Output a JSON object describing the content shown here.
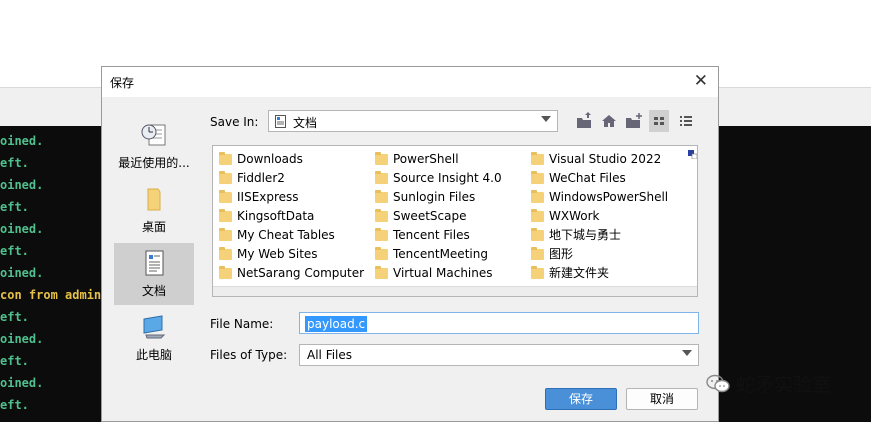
{
  "terminal": {
    "lines": [
      {
        "text": "oined.",
        "color": "green"
      },
      {
        "text": "eft.",
        "color": "green"
      },
      {
        "text": "oined.",
        "color": "green"
      },
      {
        "text": "eft.",
        "color": "green"
      },
      {
        "text": "oined.",
        "color": "green"
      },
      {
        "text": "eft.",
        "color": "green"
      },
      {
        "text": "oined.",
        "color": "green"
      },
      {
        "text": "con from admin@",
        "color": "yellow"
      },
      {
        "text": "eft.",
        "color": "green"
      },
      {
        "text": "oined.",
        "color": "green"
      },
      {
        "text": "eft.",
        "color": "green"
      },
      {
        "text": "oined.",
        "color": "green"
      },
      {
        "text": "eft.",
        "color": "green"
      }
    ]
  },
  "dialog": {
    "title": "保存",
    "close": "✕",
    "save_in": {
      "label": "Save In:",
      "value": "文档"
    },
    "places": [
      {
        "name": "recent",
        "label": "最近使用的...",
        "icon": "recent-items-icon",
        "selected": false
      },
      {
        "name": "desktop",
        "label": "桌面",
        "icon": "desktop-folder-icon",
        "selected": false
      },
      {
        "name": "documents",
        "label": "文档",
        "icon": "documents-icon",
        "selected": true
      },
      {
        "name": "this-pc",
        "label": "此电脑",
        "icon": "computer-icon",
        "selected": false
      }
    ],
    "toolbar": [
      {
        "name": "up-folder",
        "icon": "up-folder-icon"
      },
      {
        "name": "home",
        "icon": "home-icon"
      },
      {
        "name": "new-folder",
        "icon": "new-folder-icon"
      },
      {
        "name": "list-view",
        "icon": "list-view-icon",
        "active": true
      },
      {
        "name": "details-view",
        "icon": "details-view-icon"
      }
    ],
    "files": [
      [
        "Downloads",
        "Fiddler2",
        "IISExpress",
        "KingsoftData",
        "My Cheat Tables",
        "My Web Sites",
        "NetSarang Computer"
      ],
      [
        "PowerShell",
        "Source Insight 4.0",
        "Sunlogin Files",
        "SweetScape",
        "Tencent Files",
        "TencentMeeting",
        "Virtual Machines"
      ],
      [
        "Visual Studio 2022",
        "WeChat Files",
        "WindowsPowerShell",
        "WXWork",
        "地下城与勇士",
        "图形",
        "新建文件夹"
      ]
    ],
    "file_name": {
      "label": "File Name:",
      "value": "payload.c"
    },
    "file_type": {
      "label": "Files of Type:",
      "value": "All Files"
    },
    "buttons": {
      "save": "保存",
      "cancel": "取消"
    }
  },
  "watermark": {
    "text": "蛇矛实验室"
  },
  "colors": {
    "accent": "#4a90d9",
    "selection": "#3399ff",
    "folder": "#f5d27a",
    "terminal_bg": "#0c0c0c",
    "terminal_green": "#4fc08d",
    "terminal_yellow": "#e5c04a"
  }
}
